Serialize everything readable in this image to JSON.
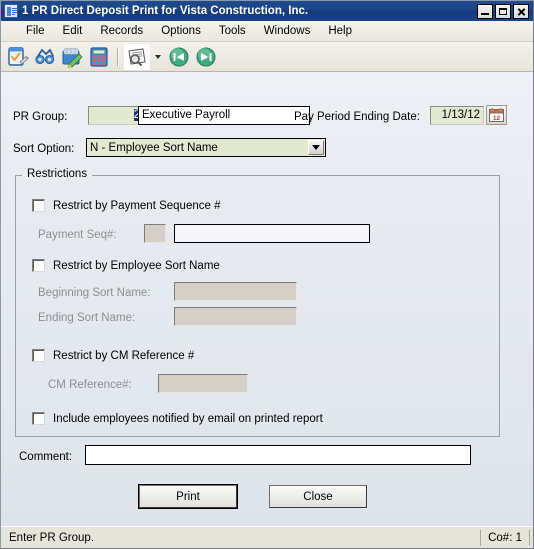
{
  "window": {
    "title": "1 PR Direct Deposit Print for Vista Construction, Inc.",
    "icon": "report-document-icon",
    "buttons": {
      "minimize": "minimize-icon",
      "maximize": "maximize-icon",
      "close": "close-icon"
    }
  },
  "menubar": {
    "items": [
      {
        "label": "File"
      },
      {
        "label": "Edit"
      },
      {
        "label": "Records"
      },
      {
        "label": "Options"
      },
      {
        "label": "Tools"
      },
      {
        "label": "Windows"
      },
      {
        "label": "Help"
      }
    ]
  },
  "toolbar": {
    "buttons": [
      {
        "name": "edit-record-icon"
      },
      {
        "name": "binoculars-find-icon"
      },
      {
        "name": "notebook-pencil-icon"
      },
      {
        "name": "calculator-icon"
      },
      {
        "name": "print-preview-icon"
      },
      {
        "name": "print-preview-dropdown-caret"
      },
      {
        "name": "previous-record-icon"
      },
      {
        "name": "next-record-icon"
      }
    ]
  },
  "form": {
    "pr_group": {
      "label": "PR Group:",
      "value": "2",
      "description": "Executive Payroll",
      "description_placeholder": ""
    },
    "pay_period": {
      "label": "Pay Period Ending Date:",
      "value": "1/13/12",
      "calendar_icon": "calendar-icon"
    },
    "sort_option": {
      "label": "Sort Option:",
      "value": "N - Employee Sort Name"
    }
  },
  "restrictions": {
    "legend": "Restrictions",
    "payment_sequence": {
      "checkbox_label": "Restrict by Payment Sequence #",
      "checked": false,
      "field_label": "Payment Seq#:",
      "code_value": "",
      "desc_value": ""
    },
    "employee_sort_name": {
      "checkbox_label": "Restrict by Employee Sort Name",
      "checked": false,
      "beginning_label": "Beginning Sort Name:",
      "beginning_value": "",
      "ending_label": "Ending Sort Name:",
      "ending_value": ""
    },
    "cm_reference": {
      "checkbox_label": "Restrict by CM Reference #",
      "checked": false,
      "field_label": "CM Reference#:",
      "value": ""
    },
    "include_email": {
      "checkbox_label": "Include employees notified by email on printed report",
      "checked": false
    }
  },
  "comment": {
    "label": "Comment:",
    "value": "",
    "placeholder": ""
  },
  "actions": {
    "print": "Print",
    "close": "Close"
  },
  "statusbar": {
    "message": "Enter PR Group.",
    "company": "Co#: 1"
  },
  "colors": {
    "titlebar": "#1c4488",
    "field_green": "#e3e9cf",
    "selection_blue": "#18377a",
    "disabled_gray": "#d4d0c8"
  }
}
